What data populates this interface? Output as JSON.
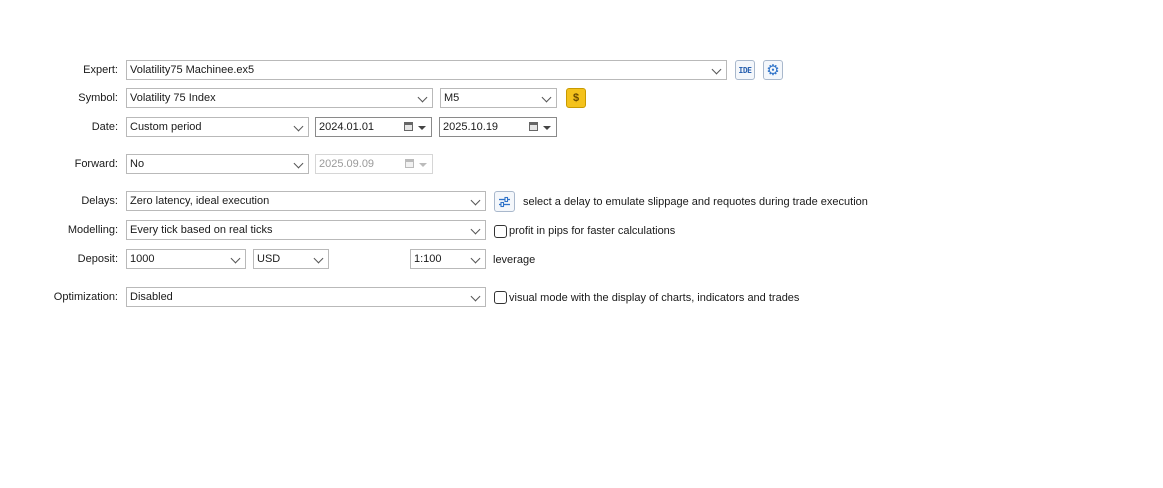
{
  "expert": {
    "label": "Expert:",
    "value": "Volatility75 Machinee.ex5"
  },
  "symbol": {
    "label": "Symbol:",
    "value": "Volatility 75 Index",
    "timeframe": "M5"
  },
  "date": {
    "label": "Date:",
    "period": "Custom period",
    "from": "2024.01.01",
    "to": "2025.10.19"
  },
  "forward": {
    "label": "Forward:",
    "value": "No",
    "date": "2025.09.09"
  },
  "delays": {
    "label": "Delays:",
    "value": "Zero latency, ideal execution",
    "hint": "select a delay to emulate slippage and requotes during trade execution"
  },
  "modelling": {
    "label": "Modelling:",
    "value": "Every tick based on real ticks",
    "checkbox_label": "profit in pips for faster calculations",
    "checked": false
  },
  "deposit": {
    "label": "Deposit:",
    "amount": "1000",
    "currency": "USD",
    "leverage_value": "1:100",
    "leverage_label": "leverage"
  },
  "optimization": {
    "label": "Optimization:",
    "value": "Disabled",
    "checkbox_label": "visual mode with the display of charts, indicators and trades",
    "checked": false
  },
  "icons": {
    "ide_text": "IDE",
    "dollar_text": "$"
  },
  "colors": {
    "accent": "#2f73c9",
    "symbol_button": "#f4c21c"
  }
}
